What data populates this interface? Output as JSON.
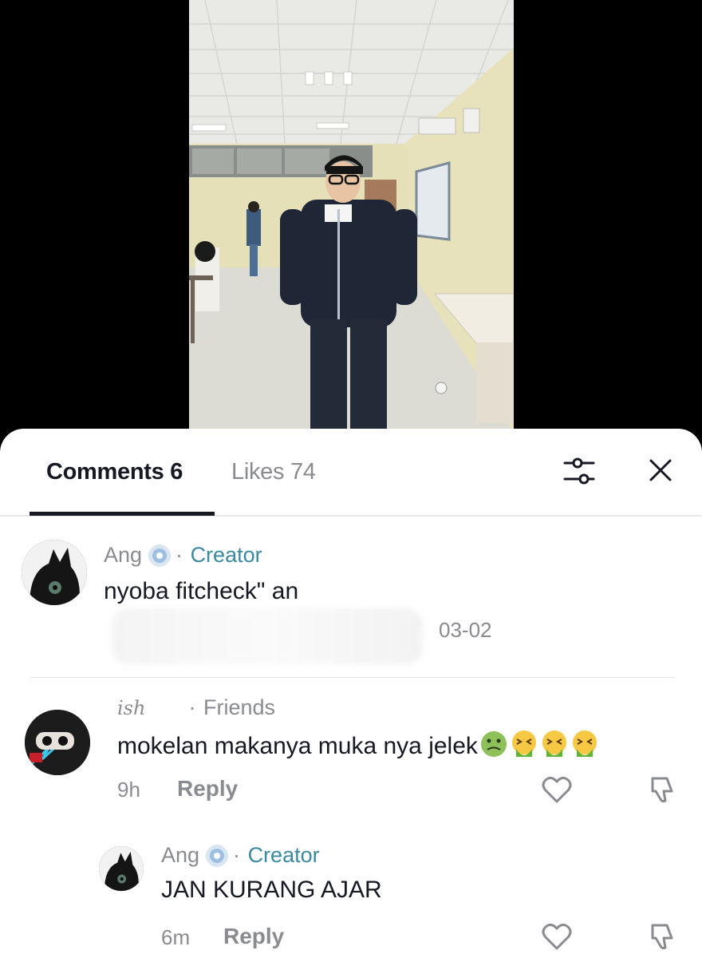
{
  "tabs": {
    "comments_label": "Comments 6",
    "likes_label": "Likes 74"
  },
  "icons": {
    "filter": "sliders-icon",
    "close": "close-icon",
    "like": "heart-icon",
    "dislike": "thumbs-down-icon"
  },
  "colors": {
    "creator_tag": "#3a8aa1",
    "text": "#161823",
    "muted": "#8a8b91"
  },
  "comments": [
    {
      "username": "Ang",
      "tag": "Creator",
      "text": "nyoba fitcheck\" an",
      "date": "03-02"
    },
    {
      "username": "ish",
      "tag": "Friends",
      "text": "mokelan makanya muka nya jelek",
      "emojis": [
        "nauseated-face",
        "vomiting-face",
        "vomiting-face",
        "vomiting-face"
      ],
      "time": "9h",
      "reply_label": "Reply"
    },
    {
      "username": "Ang",
      "tag": "Creator",
      "text": "JAN KURANG AJAR",
      "time": "6m",
      "reply_label": "Reply"
    }
  ]
}
